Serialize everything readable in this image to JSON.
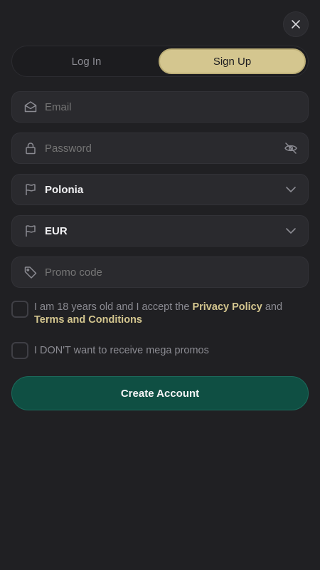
{
  "tabs": [
    {
      "label": "Log In",
      "active": false
    },
    {
      "label": "Sign Up",
      "active": true
    }
  ],
  "form": {
    "email": {
      "placeholder": "Email",
      "icon": "envelope-icon"
    },
    "password": {
      "placeholder": "Password",
      "icon": "lock-icon",
      "toggle_icon": "eye-off-icon"
    },
    "country": {
      "value": "Polonia",
      "icon": "flag-icon"
    },
    "currency": {
      "value": "EUR",
      "icon": "flag-icon"
    },
    "promo": {
      "placeholder": "Promo code",
      "icon": "tag-icon"
    }
  },
  "consent": {
    "prefix": "I am 18 years old and I accept the ",
    "privacy_link": "Privacy Policy",
    "middle": " and",
    "terms_link": "Terms and Conditions",
    "checked": false
  },
  "promos_optout": {
    "label": "I DON'T want to receive mega promos",
    "checked": false
  },
  "submit_label": "Create Account",
  "colors": {
    "background": "#202023",
    "accent": "#d4c68f",
    "button": "#0f4f43"
  }
}
